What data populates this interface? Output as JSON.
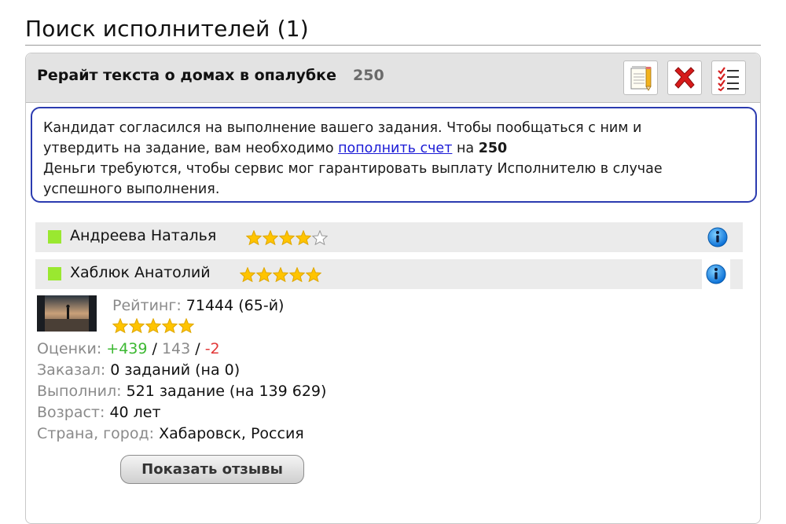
{
  "page": {
    "title": "Поиск исполнителей (1)"
  },
  "task": {
    "title": "Рерайт текста о домах в опалубке",
    "price": "250",
    "toolbar": {
      "edit_icon": "notepad-pencil-icon",
      "delete_icon": "red-x-icon",
      "checklist_icon": "checklist-icon"
    }
  },
  "notice": {
    "line1": "Кандидат согласился на выполнение вашего задания. Чтобы пообщаться с ним и",
    "line2_before": "утвердить на задание, вам необходимо ",
    "link_text": "пополнить счет",
    "line2_middle": " на ",
    "amount": "250",
    "line3": "Деньги требуются, чтобы сервис мог гарантировать выплату Исполнителю в случае",
    "line4": "успешного выполнения."
  },
  "workers": [
    {
      "name": "Андреева Наталья",
      "stars": 4,
      "max_stars": 5
    },
    {
      "name": "Хаблюк Анатолий",
      "stars": 5,
      "max_stars": 5
    }
  ],
  "details": {
    "rating_label": "Рейтинг:",
    "rating_value": "71444 (65-й)",
    "rating_stars": 5,
    "grades_label": "Оценки:",
    "grades_positive": "+439",
    "grades_sep1": " / ",
    "grades_neutral": "143",
    "grades_sep2": " / ",
    "grades_negative": "-2",
    "ordered_label": "Заказал:",
    "ordered_value": "0 заданий (на 0)",
    "completed_label": "Выполнил:",
    "completed_value": "521 задание (на 139 629)",
    "age_label": "Возраст:",
    "age_value": "40 лет",
    "location_label": "Страна, город:",
    "location_value": "Хабаровск, Россия",
    "reviews_button": "Показать отзывы"
  },
  "colors": {
    "status_online": "#9ae830",
    "star": "#ffc400",
    "positive": "#3cb832",
    "negative": "#e23838",
    "link": "#1a1ad6",
    "notice_border": "#2b3bb0"
  }
}
